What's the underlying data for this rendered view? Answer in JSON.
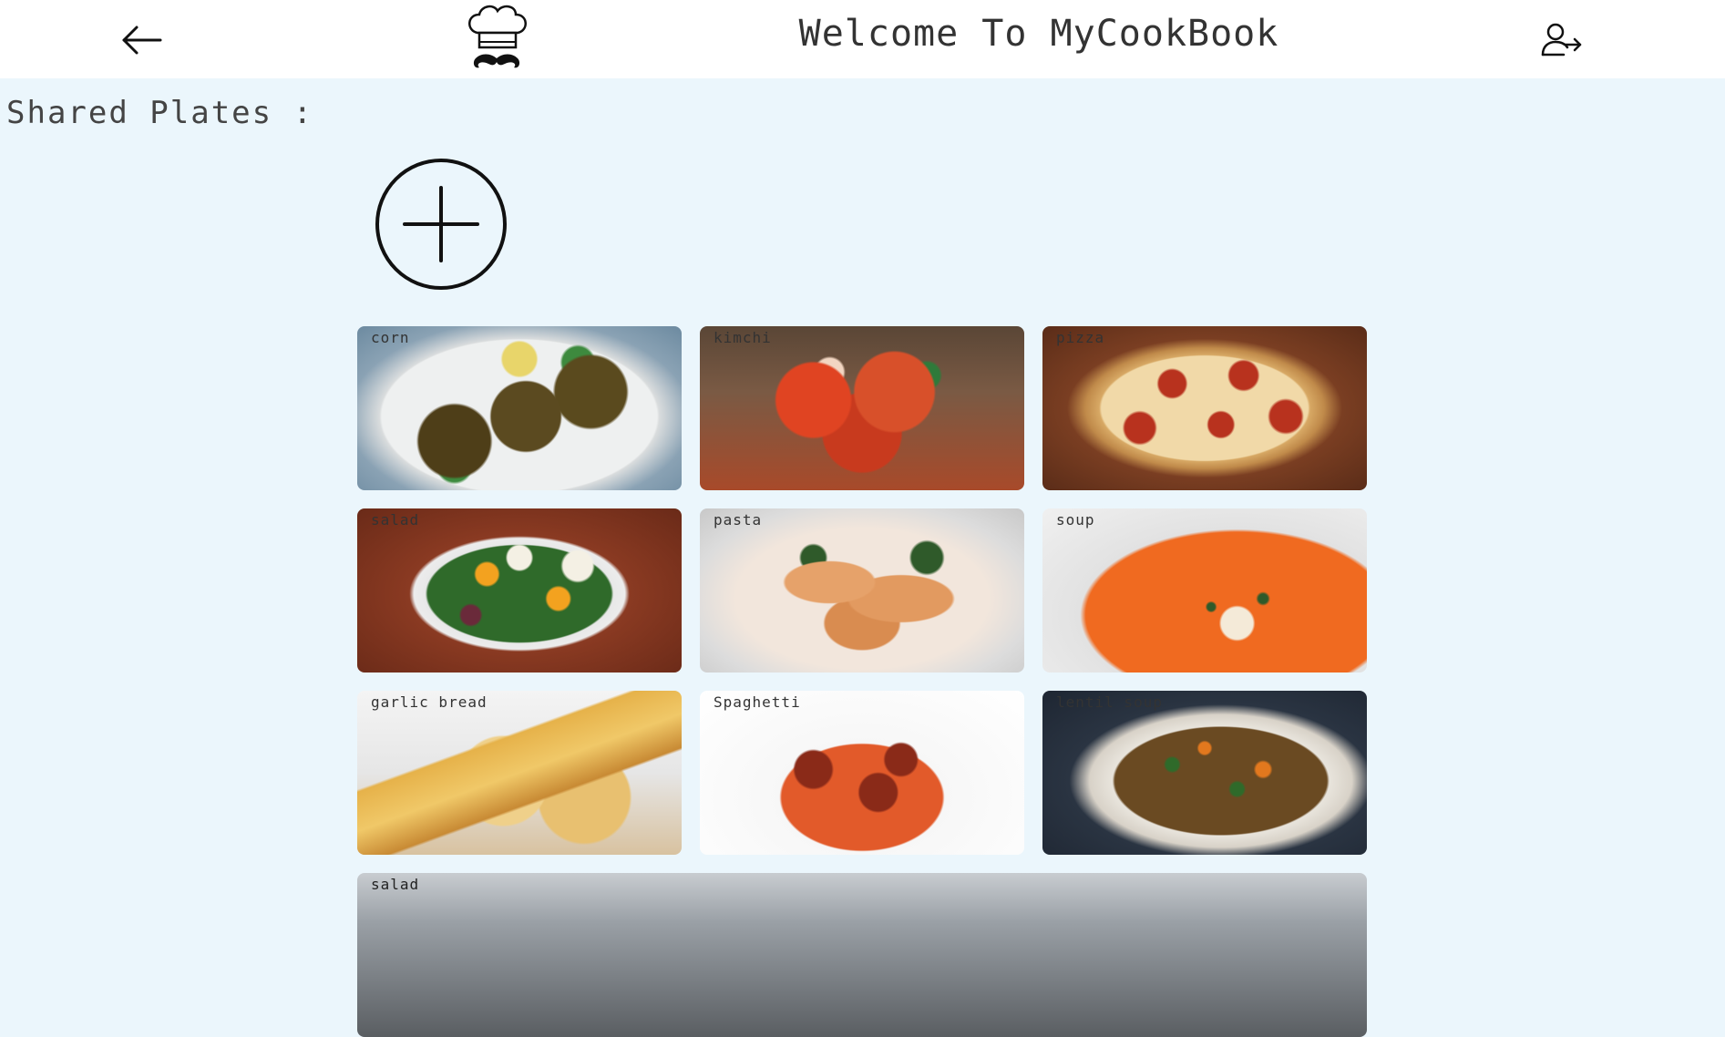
{
  "header": {
    "title": "Welcome To MyCookBook",
    "back_icon": "arrow-left-icon",
    "logo_icon": "chef-hat-mustache-logo",
    "logout_icon": "user-logout-icon"
  },
  "main": {
    "section_heading": "Shared Plates :",
    "add_button_icon": "plus-circle-icon",
    "plates": [
      {
        "label": "corn"
      },
      {
        "label": "kimchi"
      },
      {
        "label": "pizza"
      },
      {
        "label": "salad"
      },
      {
        "label": "pasta"
      },
      {
        "label": "soup"
      },
      {
        "label": "garlic bread"
      },
      {
        "label": "Spaghetti"
      },
      {
        "label": "lentil soup"
      },
      {
        "label": "salad"
      }
    ]
  },
  "colors": {
    "page_background": "#ebf6fc",
    "header_background": "#ffffff",
    "text": "#333333"
  }
}
